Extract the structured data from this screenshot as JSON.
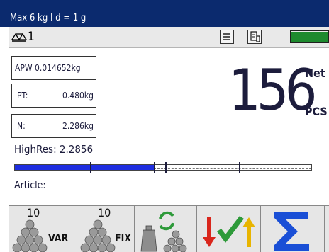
{
  "header": {
    "capacity_info": "Max 6 kg  I d = 1 g"
  },
  "status": {
    "scale_number": "1",
    "level_fraction": 1.0,
    "level_color": "#1e8a2e",
    "icons": [
      "scale-icon",
      "list-icon",
      "print-icon"
    ]
  },
  "info_fields": [
    {
      "label": "APW",
      "value": "0.014652kg",
      "full": "APW 0.014652kg"
    },
    {
      "label": "PT:",
      "value": "0.480kg"
    },
    {
      "label": "N:",
      "value": "2.286kg"
    }
  ],
  "display": {
    "value": "156",
    "net_label": "Net",
    "unit": "PCS"
  },
  "highres": {
    "text": "HighRes: 2.2856"
  },
  "bar": {
    "fill_fraction": 0.47,
    "fill_color": "#1e2ee0"
  },
  "article": {
    "label": "Article:"
  },
  "softkeys": [
    {
      "name": "var",
      "number": "10",
      "tag": "VAR"
    },
    {
      "name": "fix",
      "number": "10",
      "tag": "FIX"
    },
    {
      "name": "tare-refresh",
      "number": "",
      "tag": ""
    },
    {
      "name": "check-weigh",
      "number": "",
      "tag": ""
    },
    {
      "name": "totals",
      "number": "",
      "tag": ""
    }
  ]
}
